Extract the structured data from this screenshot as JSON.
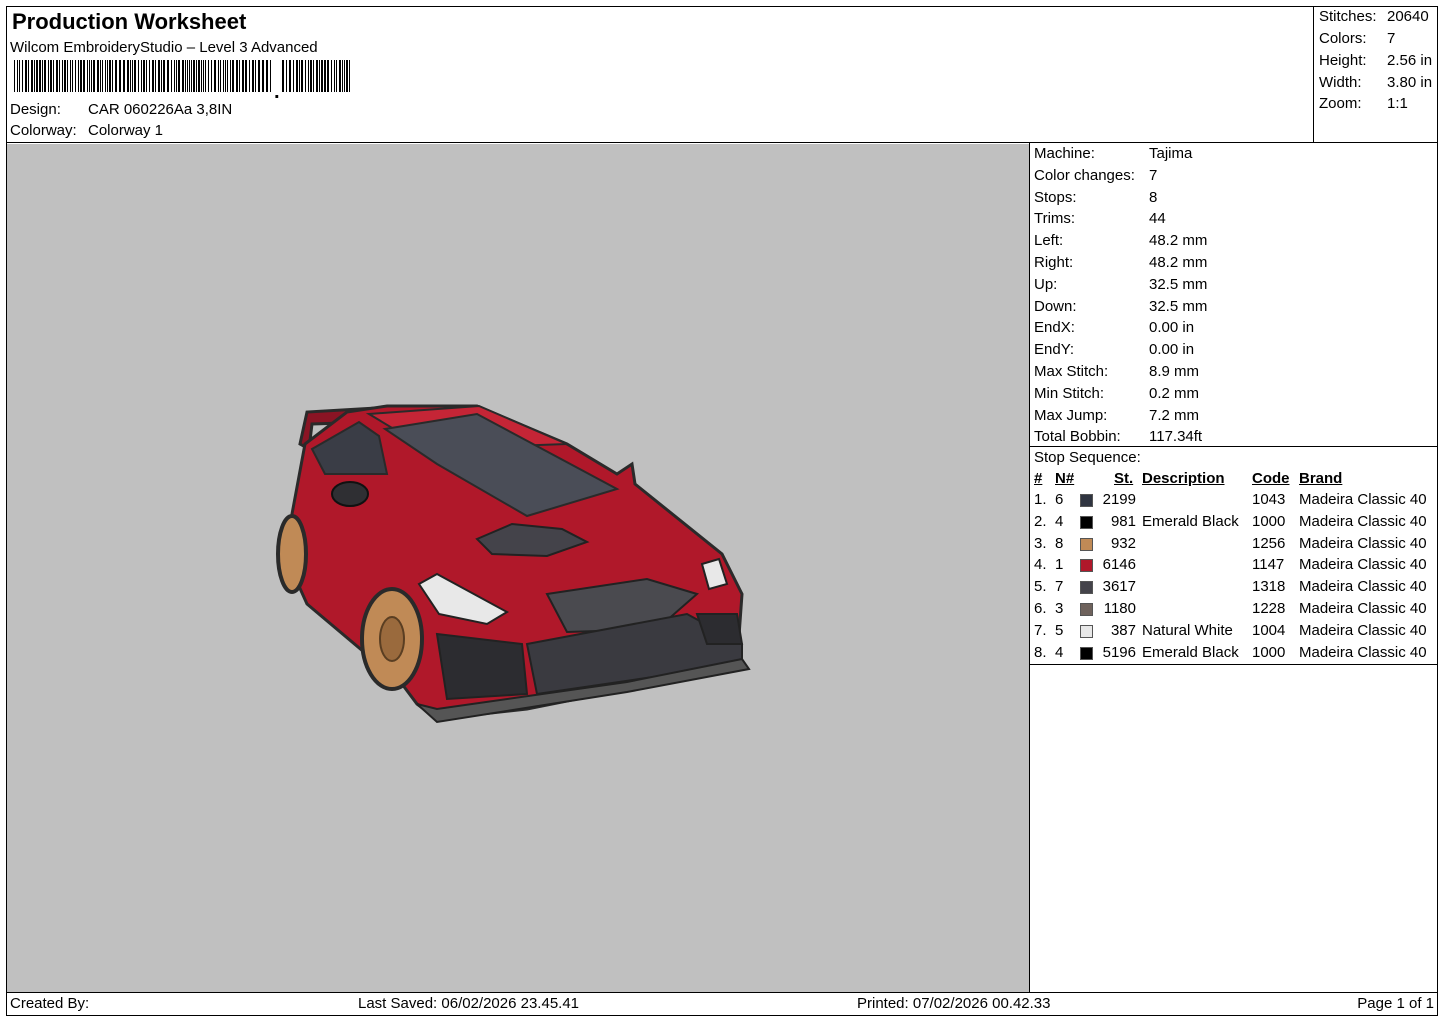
{
  "header": {
    "title": "Production Worksheet",
    "software": "Wilcom EmbroideryStudio – Level 3 Advanced",
    "design_label": "Design:",
    "design_value": "CAR 060226Aa 3,8IN",
    "colorway_label": "Colorway:",
    "colorway_value": "Colorway 1"
  },
  "stats": [
    {
      "label": "Stitches:",
      "value": "20640"
    },
    {
      "label": "Colors:",
      "value": "7"
    },
    {
      "label": "Height:",
      "value": "2.56 in"
    },
    {
      "label": "Width:",
      "value": "3.80 in"
    },
    {
      "label": "Zoom:",
      "value": "1:1"
    }
  ],
  "machine_info": [
    {
      "label": "Machine:",
      "value": "Tajima"
    },
    {
      "label": "Color changes:",
      "value": "7"
    },
    {
      "label": "Stops:",
      "value": "8"
    },
    {
      "label": "Trims:",
      "value": "44"
    },
    {
      "label": "Left:",
      "value": "48.2 mm"
    },
    {
      "label": "Right:",
      "value": "48.2 mm"
    },
    {
      "label": "Up:",
      "value": "32.5 mm"
    },
    {
      "label": "Down:",
      "value": "32.5 mm"
    },
    {
      "label": "EndX:",
      "value": "0.00 in"
    },
    {
      "label": "EndY:",
      "value": "0.00 in"
    },
    {
      "label": "Max Stitch:",
      "value": "8.9 mm"
    },
    {
      "label": "Min Stitch:",
      "value": "0.2 mm"
    },
    {
      "label": "Max Jump:",
      "value": "7.2 mm"
    },
    {
      "label": "Total Bobbin:",
      "value": "117.34ft"
    }
  ],
  "stop_sequence": {
    "title": "Stop Sequence:",
    "headers": {
      "num": "#",
      "n": "N#",
      "st": "St.",
      "description": "Description",
      "code": "Code",
      "brand": "Brand"
    },
    "rows": [
      {
        "num": "1.",
        "n": "6",
        "color": "#2f3440",
        "st": "2199",
        "description": "",
        "code": "1043",
        "brand": "Madeira Classic 40"
      },
      {
        "num": "2.",
        "n": "4",
        "color": "#000000",
        "st": "981",
        "description": "Emerald Black",
        "code": "1000",
        "brand": "Madeira Classic 40"
      },
      {
        "num": "3.",
        "n": "8",
        "color": "#c08a56",
        "st": "932",
        "description": "",
        "code": "1256",
        "brand": "Madeira Classic 40"
      },
      {
        "num": "4.",
        "n": "1",
        "color": "#b0182a",
        "st": "6146",
        "description": "",
        "code": "1147",
        "brand": "Madeira Classic 40"
      },
      {
        "num": "5.",
        "n": "7",
        "color": "#44434a",
        "st": "3617",
        "description": "",
        "code": "1318",
        "brand": "Madeira Classic 40"
      },
      {
        "num": "6.",
        "n": "3",
        "color": "#6e625c",
        "st": "1180",
        "description": "",
        "code": "1228",
        "brand": "Madeira Classic 40"
      },
      {
        "num": "7.",
        "n": "5",
        "color": "#e8e8e8",
        "st": "387",
        "description": "Natural White",
        "code": "1004",
        "brand": "Madeira Classic 40"
      },
      {
        "num": "8.",
        "n": "4",
        "color": "#000000",
        "st": "5196",
        "description": "Emerald Black",
        "code": "1000",
        "brand": "Madeira Classic 40"
      }
    ]
  },
  "footer": {
    "created_by": "Created By:",
    "last_saved": "Last Saved: 06/02/2026 23.45.41",
    "printed": "Printed: 07/02/2026 00.42.33",
    "page": "Page 1 of 1"
  },
  "colors": {
    "preview_bg": "#c0c0c0",
    "car_body": "#b0182a",
    "wheels": "#c08a56"
  }
}
